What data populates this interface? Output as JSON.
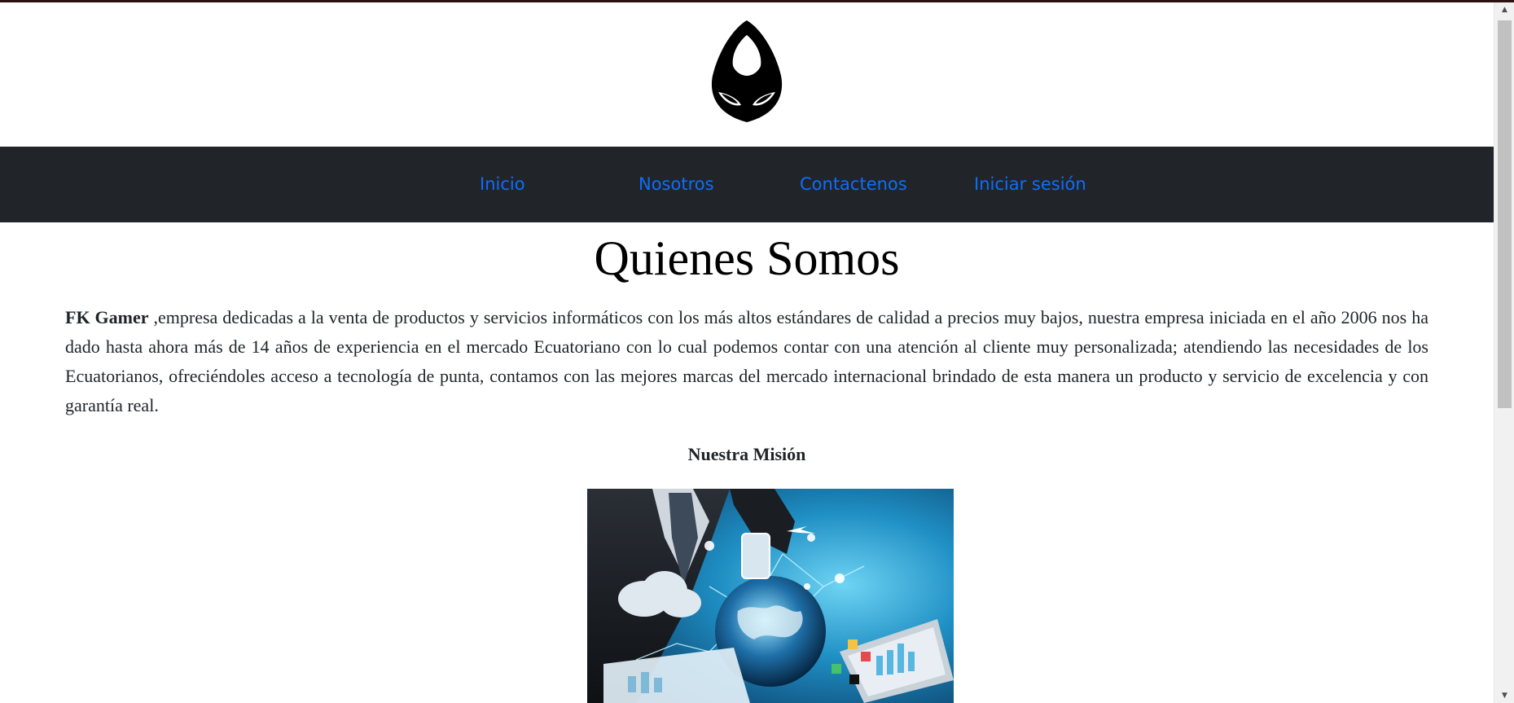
{
  "brand": {
    "logo_icon": "hooded-mask-logo"
  },
  "nav": {
    "items": [
      {
        "label": "Inicio"
      },
      {
        "label": "Nosotros"
      },
      {
        "label": "Contactenos"
      },
      {
        "label": "Iniciar sesión"
      }
    ]
  },
  "about": {
    "title": "Quienes Somos",
    "company_name": "FK Gamer",
    "description": " ,empresa dedicadas a la venta de productos y servicios informáticos con los más altos estándares de calidad a precios muy bajos, nuestra empresa iniciada en el año 2006 nos ha dado hasta ahora más de 14 años de experiencia en el mercado Ecuatoriano con lo cual podemos contar con una atención al cliente muy personalizada; atendiendo las necesidades de los Ecuatorianos, ofreciéndoles acceso a tecnología de punta, contamos con las mejores marcas del mercado internacional brindado de esta manera un producto y servicio de excelencia y con garantía real.",
    "mission_heading": "Nuestra Misión"
  },
  "colors": {
    "navbar_bg": "#212529",
    "link": "#0d6efd",
    "text": "#212529"
  }
}
